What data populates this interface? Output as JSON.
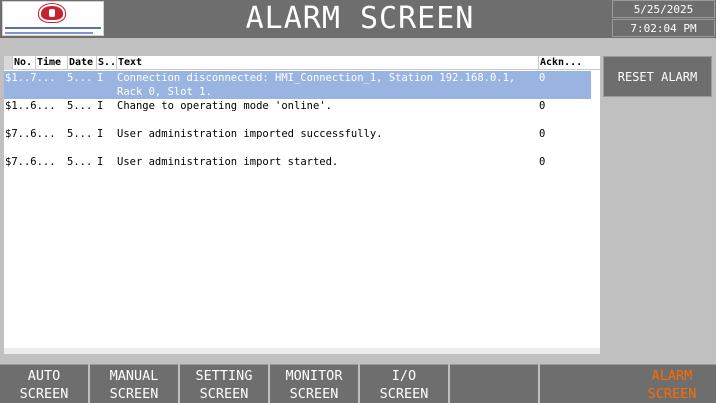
{
  "header": {
    "title": "ALARM SCREEN",
    "date": "5/25/2025",
    "time": "7:02:04 PM"
  },
  "alarm_table": {
    "columns": [
      "No.",
      "Time",
      "Date",
      "S..",
      "Text",
      "Ackn..."
    ],
    "rows": [
      {
        "no": "$1..7...",
        "date": "5...",
        "status": "I",
        "text": "Connection disconnected: HMI_Connection_1, Station 192.168.0.1, Rack 0, Slot 1.",
        "ack": "0",
        "selected": true
      },
      {
        "no": "$1..6...",
        "date": "5...",
        "status": "I",
        "text": "Change to operating mode 'online'.",
        "ack": "0",
        "selected": false
      },
      {
        "no": "$7..6...",
        "date": "5...",
        "status": "I",
        "text": "User administration imported successfully.",
        "ack": "0",
        "selected": false
      },
      {
        "no": "$7..6...",
        "date": "5...",
        "status": "I",
        "text": "User administration import started.",
        "ack": "0",
        "selected": false
      }
    ]
  },
  "reset_button": {
    "label": "RESET ALARM"
  },
  "nav": [
    {
      "line1": "AUTO",
      "line2": "SCREEN"
    },
    {
      "line1": "MANUAL",
      "line2": "SCREEN"
    },
    {
      "line1": "SETTING",
      "line2": "SCREEN"
    },
    {
      "line1": "MONITOR",
      "line2": "SCREEN"
    },
    {
      "line1": "I/O",
      "line2": "SCREEN"
    },
    {
      "line1": "",
      "line2": ""
    },
    {
      "line1": "",
      "line2": ""
    },
    {
      "line1": "ALARM",
      "line2": "SCREEN"
    }
  ],
  "colors": {
    "header_bg": "#6e6e6e",
    "panel_bg": "#c0c0c0",
    "selected_row": "#99b4e0",
    "active_nav_text": "#ff6a00"
  }
}
